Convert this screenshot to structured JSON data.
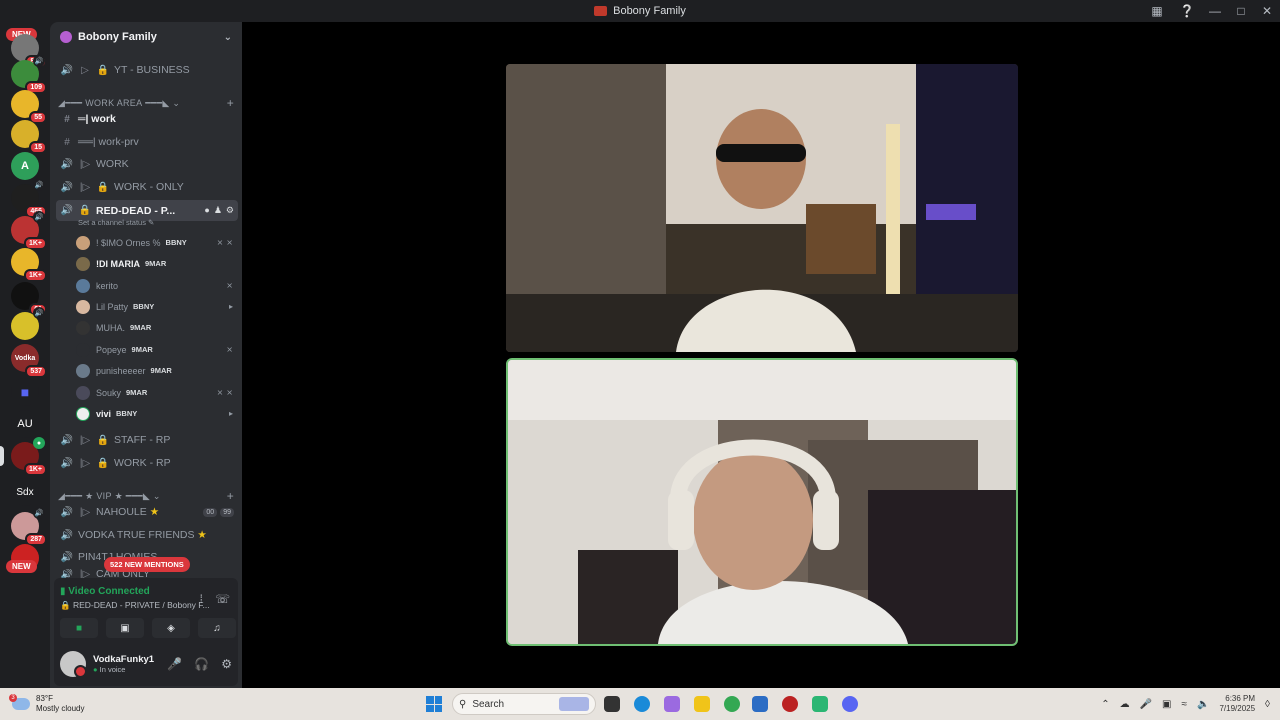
{
  "window": {
    "title": "Bobony Family"
  },
  "servers": {
    "new_top": "NEW",
    "new_bottom": "NEW",
    "badges": [
      "868",
      "109",
      "55",
      "15",
      "466",
      "1K+",
      "1K+",
      "61",
      "537",
      "1K+",
      "287"
    ],
    "text_icons": [
      "A",
      "AU",
      "Sdx"
    ]
  },
  "guild": {
    "name": "Bobony Family"
  },
  "channels": {
    "yt_business": "YT - BUSINESS",
    "work_area": "WORK AREA",
    "work": "work",
    "work_prv": "work-prv",
    "work2": "WORK",
    "work_only": "WORK - ONLY",
    "red_dead": "RED-DEAD - P...",
    "set_status": "Set a channel status",
    "staff_rp": "STAFF - RP",
    "work_rp": "WORK - RP",
    "vip": "VIP",
    "nahoule": "NAHOULE",
    "nahoule_counts": [
      "00",
      "99"
    ],
    "vodka_friends": "VODKA TRUE FRIENDS",
    "pin_homies": "PIN4TJ HOMIES",
    "cam_only": "CAM ONLY"
  },
  "members": [
    {
      "name": "! $IMO Ornes %",
      "tag": "BBNY"
    },
    {
      "name": "!DI MARIA",
      "tag": "9MAR"
    },
    {
      "name": "kerito",
      "tag": ""
    },
    {
      "name": "Lil Patty",
      "tag": "BBNY"
    },
    {
      "name": "MUHA.",
      "tag": "9MAR"
    },
    {
      "name": "Popeye",
      "tag": "9MAR"
    },
    {
      "name": "punisheeeer",
      "tag": "9MAR"
    },
    {
      "name": "Souky",
      "tag": "9MAR"
    },
    {
      "name": "vivi",
      "tag": "BBNY"
    }
  ],
  "mentions": "522 NEW MENTIONS",
  "voice": {
    "status": "Video Connected",
    "channel": "RED-DEAD - PRIVATE / Bobony F..."
  },
  "user": {
    "name": "VodkaFunky1",
    "status": "In voice"
  },
  "taskbar": {
    "temp": "83°F",
    "weather": "Mostly cloudy",
    "search": "Search",
    "time": "6:36 PM",
    "date": "7/19/2025"
  }
}
